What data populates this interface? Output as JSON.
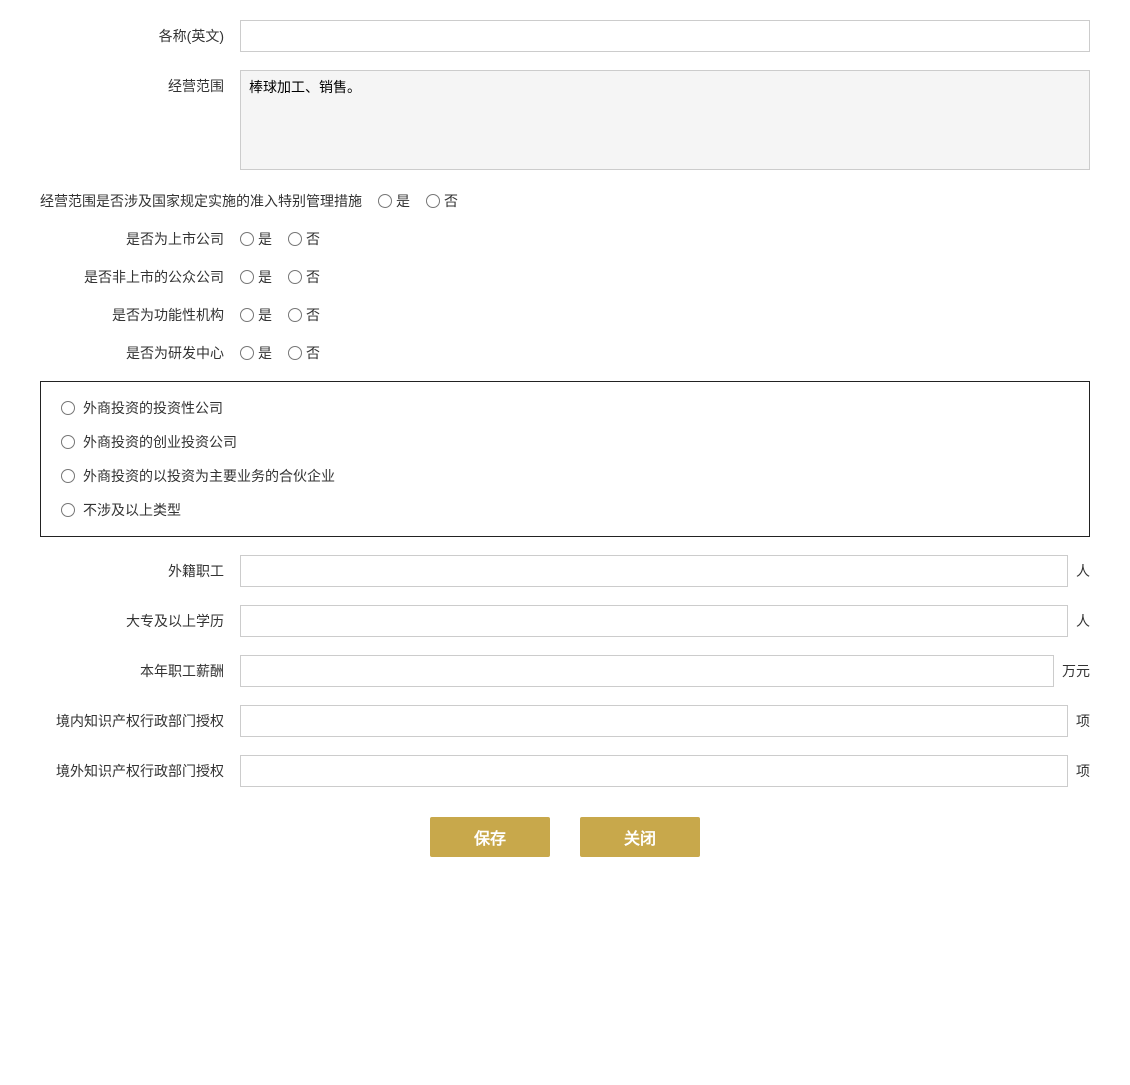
{
  "form": {
    "english_name_label": "各称(英文)",
    "english_name_placeholder": "",
    "business_scope_label": "经营范围",
    "business_scope_value": "棒球加工、销售。",
    "special_management_label": "经营范围是否涉及国家规定实施的准入特别管理措施",
    "special_management_yes": "是",
    "special_management_no": "否",
    "listed_company_label": "是否为上市公司",
    "listed_company_yes": "是",
    "listed_company_no": "否",
    "non_listed_public_label": "是否非上市的公众公司",
    "non_listed_public_yes": "是",
    "non_listed_public_no": "否",
    "functional_org_label": "是否为功能性机构",
    "functional_org_yes": "是",
    "functional_org_no": "否",
    "research_center_label": "是否为研发中心",
    "research_center_yes": "是",
    "research_center_no": "否",
    "investment_type_options": [
      "外商投资的投资性公司",
      "外商投资的创业投资公司",
      "外商投资的以投资为主要业务的合伙企业",
      "不涉及以上类型"
    ],
    "foreign_workers_label": "外籍职工",
    "foreign_workers_unit": "人",
    "college_above_label": "大专及以上学历",
    "college_above_unit": "人",
    "annual_salary_label": "本年职工薪酬",
    "annual_salary_unit": "万元",
    "domestic_ip_label": "境内知识产权行政部门授权",
    "domestic_ip_unit": "项",
    "foreign_ip_label": "境外知识产权行政部门授权",
    "foreign_ip_unit": "项",
    "save_button": "保存",
    "close_button": "关闭"
  }
}
